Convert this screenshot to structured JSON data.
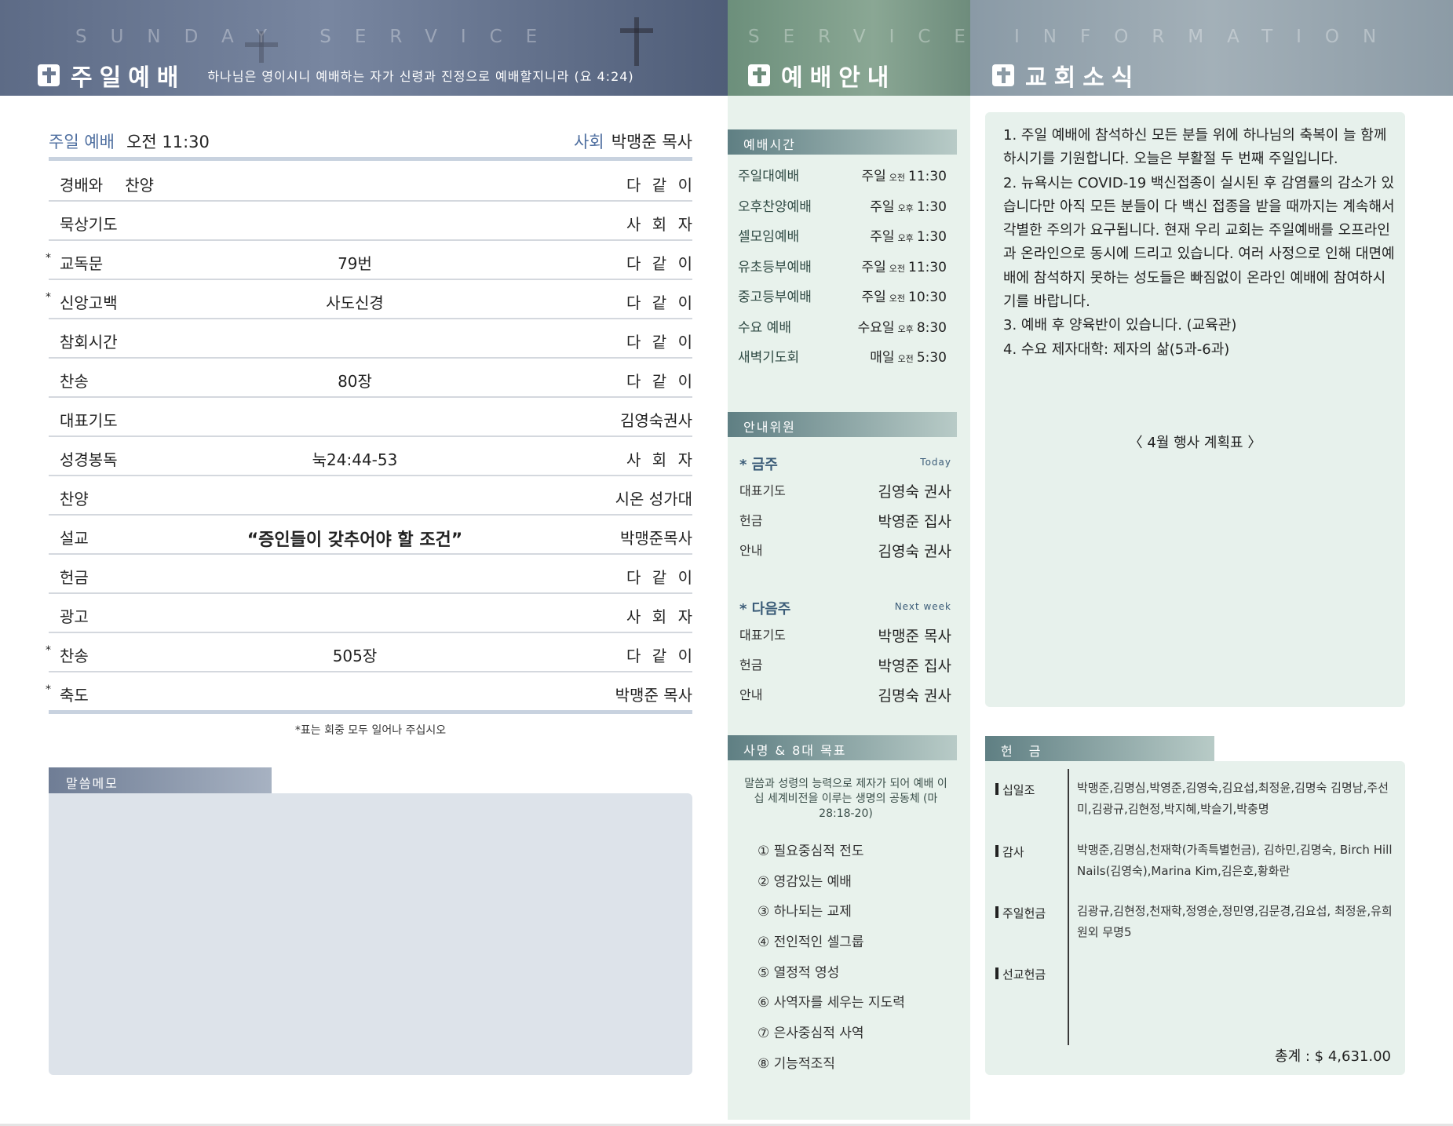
{
  "header": {
    "sunday": {
      "watermark": "SUNDAY SERVICE",
      "title": "주일예배",
      "verse": "하나님은 영이시니 예배하는 자가 신령과 진정으로 예배할지니라 (요 4:24)"
    },
    "service": {
      "watermark": "SERVICE",
      "title": "예배안내"
    },
    "info": {
      "watermark": "INFORMATION",
      "title": "교회소식"
    }
  },
  "service_order": {
    "service_label": "주일 예배",
    "service_time": "오전 11:30",
    "host_label": "사회",
    "host_name": "박맹준 목사",
    "rows": [
      {
        "mark": "",
        "item": "경배와 찬양",
        "detail": "",
        "who": "다 같 이"
      },
      {
        "mark": "",
        "item": "묵상기도",
        "detail": "",
        "who": "사 회 자"
      },
      {
        "mark": "*",
        "item": "교독문",
        "detail": "79번",
        "who": "다 같 이"
      },
      {
        "mark": "*",
        "item": "신앙고백",
        "detail": "사도신경",
        "who": "다 같 이"
      },
      {
        "mark": "",
        "item": "참회시간",
        "detail": "",
        "who": "다 같 이"
      },
      {
        "mark": "",
        "item": "찬송",
        "detail": "80장",
        "who": "다 같 이"
      },
      {
        "mark": "",
        "item": "대표기도",
        "detail": "",
        "who": "김영숙권사"
      },
      {
        "mark": "",
        "item": "성경봉독",
        "detail": "눅24:44-53",
        "who": "사 회 자"
      },
      {
        "mark": "",
        "item": "찬양",
        "detail": "",
        "who": "시온 성가대"
      },
      {
        "mark": "",
        "item": "설교",
        "detail": "“증인들이 갖추어야 할 조건”",
        "who": "박맹준목사"
      },
      {
        "mark": "",
        "item": "헌금",
        "detail": "",
        "who": "다 같 이"
      },
      {
        "mark": "",
        "item": "광고",
        "detail": "",
        "who": "사 회 자"
      },
      {
        "mark": "*",
        "item": "찬송",
        "detail": "505장",
        "who": "다 같 이"
      },
      {
        "mark": "*",
        "item": "축도",
        "detail": "",
        "who": "박맹준 목사"
      }
    ],
    "note": "*표는 회중 모두 일어나 주십시오",
    "memo_label": "말씀메모"
  },
  "worship_times": {
    "label": "예배시간",
    "rows": [
      {
        "name": "주일대예배",
        "day": "주일",
        "ampm": "오전",
        "time": "11:30"
      },
      {
        "name": "오후찬양예배",
        "day": "주일",
        "ampm": "오후",
        "time": "1:30"
      },
      {
        "name": "셀모임예배",
        "day": "주일",
        "ampm": "오후",
        "time": "1:30"
      },
      {
        "name": "유초등부예배",
        "day": "주일",
        "ampm": "오전",
        "time": "11:30"
      },
      {
        "name": "중고등부예배",
        "day": "주일",
        "ampm": "오전",
        "time": "10:30"
      },
      {
        "name": "수요 예배",
        "day": "수요일",
        "ampm": "오후",
        "time": "8:30"
      },
      {
        "name": "새벽기도회",
        "day": "매일",
        "ampm": "오전",
        "time": "5:30"
      }
    ]
  },
  "ushers": {
    "label": "안내위원",
    "this_week": {
      "title": "* 금주",
      "tag": "Today",
      "rows": [
        {
          "role": "대표기도",
          "person": "김영숙 권사"
        },
        {
          "role": "헌금",
          "person": "박영준 집사"
        },
        {
          "role": "안내",
          "person": "김영숙 권사"
        }
      ]
    },
    "next_week": {
      "title": "* 다음주",
      "tag": "Next week",
      "rows": [
        {
          "role": "대표기도",
          "person": "박맹준 목사"
        },
        {
          "role": "헌금",
          "person": "박영준 집사"
        },
        {
          "role": "안내",
          "person": "김명숙 권사"
        }
      ]
    }
  },
  "mission": {
    "label": "사명 & 8대 목표",
    "statement": "말씀과 성령의 능력으로 제자가 되어 예배 이십 세계비전을 이루는 생명의 공동체 (마 28:18-20)",
    "goals": [
      "① 필요중심적 전도",
      "② 영감있는 예배",
      "③ 하나되는 교제",
      "④ 전인적인 셀그룹",
      "⑤ 열정적 영성",
      "⑥ 사역자를 세우는 지도력",
      "⑦ 은사중심적 사역",
      "⑧ 기능적조직"
    ]
  },
  "news": {
    "paragraphs": [
      "1. 주일 예배에 참석하신 모든 분들 위에 하나님의 축복이 늘 함께 하시기를 기원합니다. 오늘은 부활절 두 번째 주일입니다.",
      "2. 뉴욕시는 COVID-19 백신접종이 실시된 후 감염률의 감소가  있습니다만 아직 모든 분들이 다 백신 접종을 받을 때까지는 계속해서 각별한 주의가 요구됩니다. 현재 우리 교회는 주일예배를 오프라인과 온라인으로 동시에 드리고 있습니다. 여러 사정으로 인해 대면예배에 참석하지 못하는 성도들은 빠짐없이 온라인 예배에 참여하시기를 바랍니다.",
      "3. 예배 후 양육반이 있습니다. (교육관)",
      "4. 수요 제자대학: 제자의 삶(5과-6과)"
    ],
    "plan": "〈  4월 행사 계획표  〉"
  },
  "offering": {
    "label": "헌 금",
    "rows": [
      {
        "category": "십일조",
        "names": "박맹준,김명심,박영준,김영숙,김요섭,최정윤,김명숙 김명남,주선미,김광규,김현정,박지혜,박슬기,박충명"
      },
      {
        "category": "감사",
        "names": "박맹준,김명심,천재학(가족특별헌금),      김하민,김명숙, Birch Hill Nails(김영숙),Marina Kim,김은호,황화란"
      },
      {
        "category": "주일헌금",
        "names": "김광규,김현정,천재학,정영순,정민영,김문경,김요섭, 최정윤,유희원외 무명5"
      },
      {
        "category": "선교헌금",
        "names": ""
      }
    ],
    "total": "총계 : $ 4,631.00"
  }
}
